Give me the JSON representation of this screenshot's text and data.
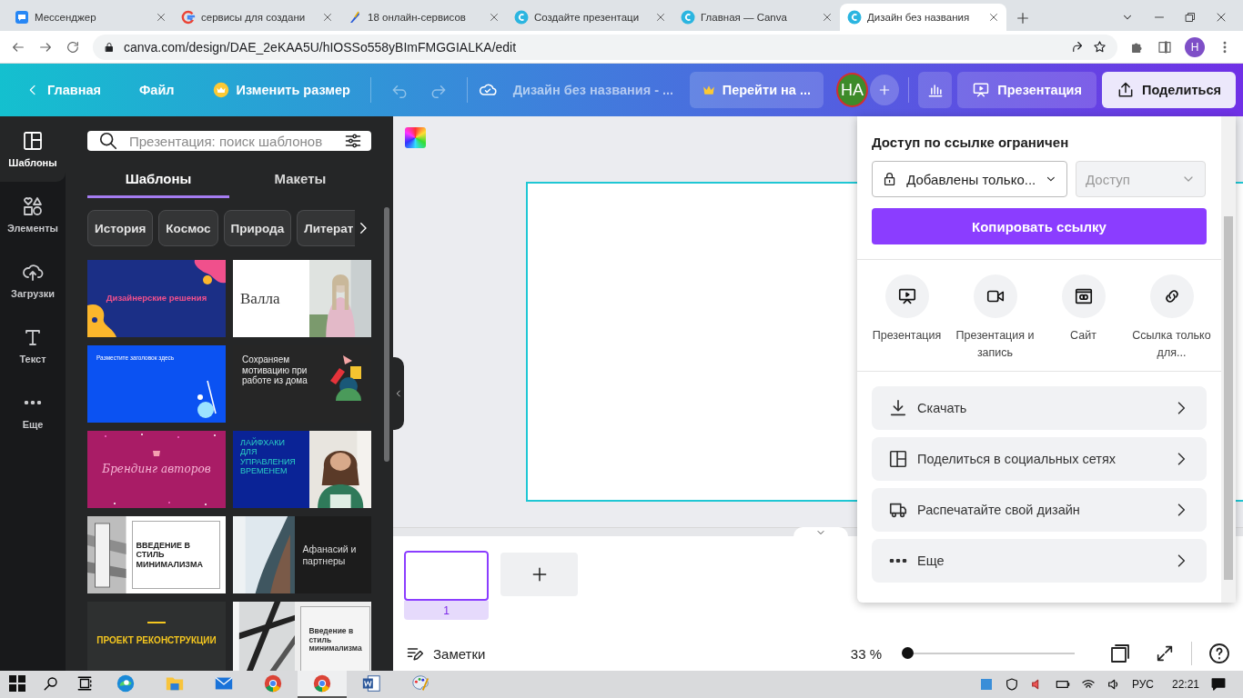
{
  "browser": {
    "tabs": [
      {
        "title": "Мессенджер",
        "kind": "messenger",
        "selected": false
      },
      {
        "title": "сервисы для создани",
        "kind": "google",
        "selected": false
      },
      {
        "title": "18 онлайн-сервисов",
        "kind": "article",
        "selected": false
      },
      {
        "title": "Создайте презентаци",
        "kind": "canva",
        "selected": false
      },
      {
        "title": "Главная — Canva",
        "kind": "canva",
        "selected": false
      },
      {
        "title": "Дизайн без названия",
        "kind": "canva",
        "selected": true
      }
    ],
    "url": "canva.com/design/DAE_2eKAA5U/hIOSSo558yBImFMGGIALKA/edit",
    "profile": "Н"
  },
  "toolbar": {
    "home": "Главная",
    "file": "Файл",
    "resize": "Изменить размер",
    "undo": {
      "disabled": true
    },
    "redo": {
      "disabled": true
    },
    "doc_title": "Дизайн без названия - ...",
    "upgrade": "Перейти на ...",
    "avatar": "НА",
    "present": "Презентация",
    "share": "Поделиться"
  },
  "sidebar": {
    "items": [
      {
        "label": "Шаблоны",
        "kind": "templates",
        "selected": true
      },
      {
        "label": "Элементы",
        "kind": "elements",
        "selected": false
      },
      {
        "label": "Загрузки",
        "kind": "uploads",
        "selected": false
      },
      {
        "label": "Текст",
        "kind": "text",
        "selected": false
      },
      {
        "label": "Еще",
        "kind": "more",
        "selected": false
      }
    ]
  },
  "panel": {
    "search": {
      "placeholder": "Презентация: поиск шаблонов"
    },
    "tabs": [
      {
        "label": "Шаблоны",
        "selected": true
      },
      {
        "label": "Макеты",
        "selected": false
      }
    ],
    "chips": [
      "История",
      "Космос",
      "Природа",
      "Литерат"
    ],
    "templates": [
      {
        "title": "Дизайнерские решения",
        "kind": "navy"
      },
      {
        "title": "Валла",
        "kind": "white-photo"
      },
      {
        "title": "Разместите заголовок здесь",
        "kind": "blue"
      },
      {
        "title": "Сохраняем мотивацию при работе из дома",
        "kind": "dark"
      },
      {
        "title": "Брендинг авторов",
        "kind": "magenta"
      },
      {
        "title": "ЛАЙФХАКИ ДЛЯ УПРАВЛЕНИЯ ВРЕМЕНЕМ",
        "kind": "navy-photo"
      },
      {
        "title": "ВВЕДЕНИЕ В СТИЛЬ МИНИМАЛИЗМА",
        "kind": "minimal"
      },
      {
        "title": "Афанасий и партнеры",
        "kind": "dark-photo"
      },
      {
        "title": "ПРОЕКТ РЕКОНСТРУКЦИИ",
        "kind": "construction"
      },
      {
        "title": "Введение в стиль минимализма",
        "kind": "minimal-photo"
      }
    ]
  },
  "canvas": {
    "pages": [
      {
        "number": "1",
        "selected": true
      }
    ],
    "notes": "Заметки",
    "zoom": {
      "reading": "33 %",
      "level": 0
    }
  },
  "share": {
    "heading": "Доступ по ссылке ограничен",
    "access": {
      "value": "Добавлены только..."
    },
    "role": {
      "placeholder": "Доступ",
      "disabled": true
    },
    "copy_button": "Копировать ссылку",
    "options": [
      {
        "label": "Презентация",
        "kind": "present"
      },
      {
        "label": "Презентация и запись",
        "kind": "record"
      },
      {
        "label": "Сайт",
        "kind": "website"
      },
      {
        "label": "Ссылка только для...",
        "kind": "link"
      }
    ],
    "actions": [
      {
        "label": "Скачать",
        "kind": "download"
      },
      {
        "label": "Поделиться в социальных сетях",
        "kind": "social"
      },
      {
        "label": "Распечатайте свой дизайн",
        "kind": "print"
      },
      {
        "label": "Еще",
        "kind": "more"
      }
    ]
  },
  "taskbar": {
    "apps": [
      {
        "kind": "edge",
        "active": false
      },
      {
        "kind": "explorer",
        "active": false
      },
      {
        "kind": "mail",
        "active": false
      },
      {
        "kind": "chrome",
        "active": false
      },
      {
        "kind": "chrome",
        "active": true
      },
      {
        "kind": "word",
        "active": false
      },
      {
        "kind": "paint",
        "active": false
      }
    ],
    "language": "РУС",
    "time": "22:21"
  }
}
